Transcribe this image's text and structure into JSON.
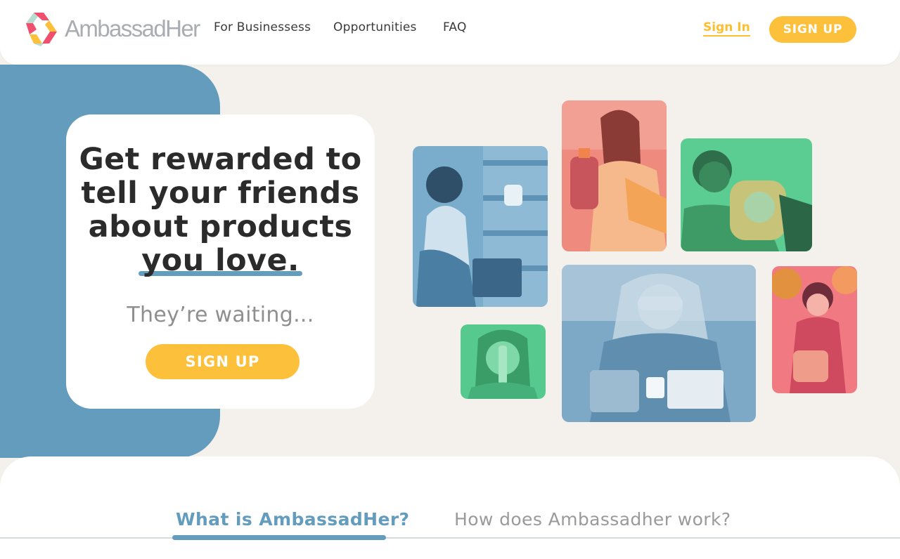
{
  "brand": {
    "name": "AmbassadHer",
    "colors": {
      "blue": "#649cbe",
      "yellow": "#fdc03a",
      "red": "#f0506e",
      "green": "#4ec98e",
      "background": "#f4f1ec"
    }
  },
  "nav": {
    "links": [
      "For Businessess",
      "Opportunities",
      "FAQ"
    ],
    "signin": "Sign In",
    "signup": "SIGN UP"
  },
  "hero": {
    "title_line1": "Get rewarded to",
    "title_line2": "tell your friends",
    "title_line3": "about products",
    "title_line4": "you love.",
    "subtitle": "They’re waiting...",
    "cta": "SIGN UP"
  },
  "photos": [
    {
      "name": "photo-woman-grocery",
      "tint": "blue"
    },
    {
      "name": "photo-woman-detergent",
      "tint": "red"
    },
    {
      "name": "photo-woman-tide",
      "tint": "green"
    },
    {
      "name": "photo-woman-sipping",
      "tint": "green"
    },
    {
      "name": "photo-woman-eyemask",
      "tint": "blue"
    },
    {
      "name": "photo-woman-garden",
      "tint": "red"
    }
  ],
  "tabs": {
    "active": "What is AmbassadHer?",
    "inactive": "How does Ambassadher work?"
  }
}
